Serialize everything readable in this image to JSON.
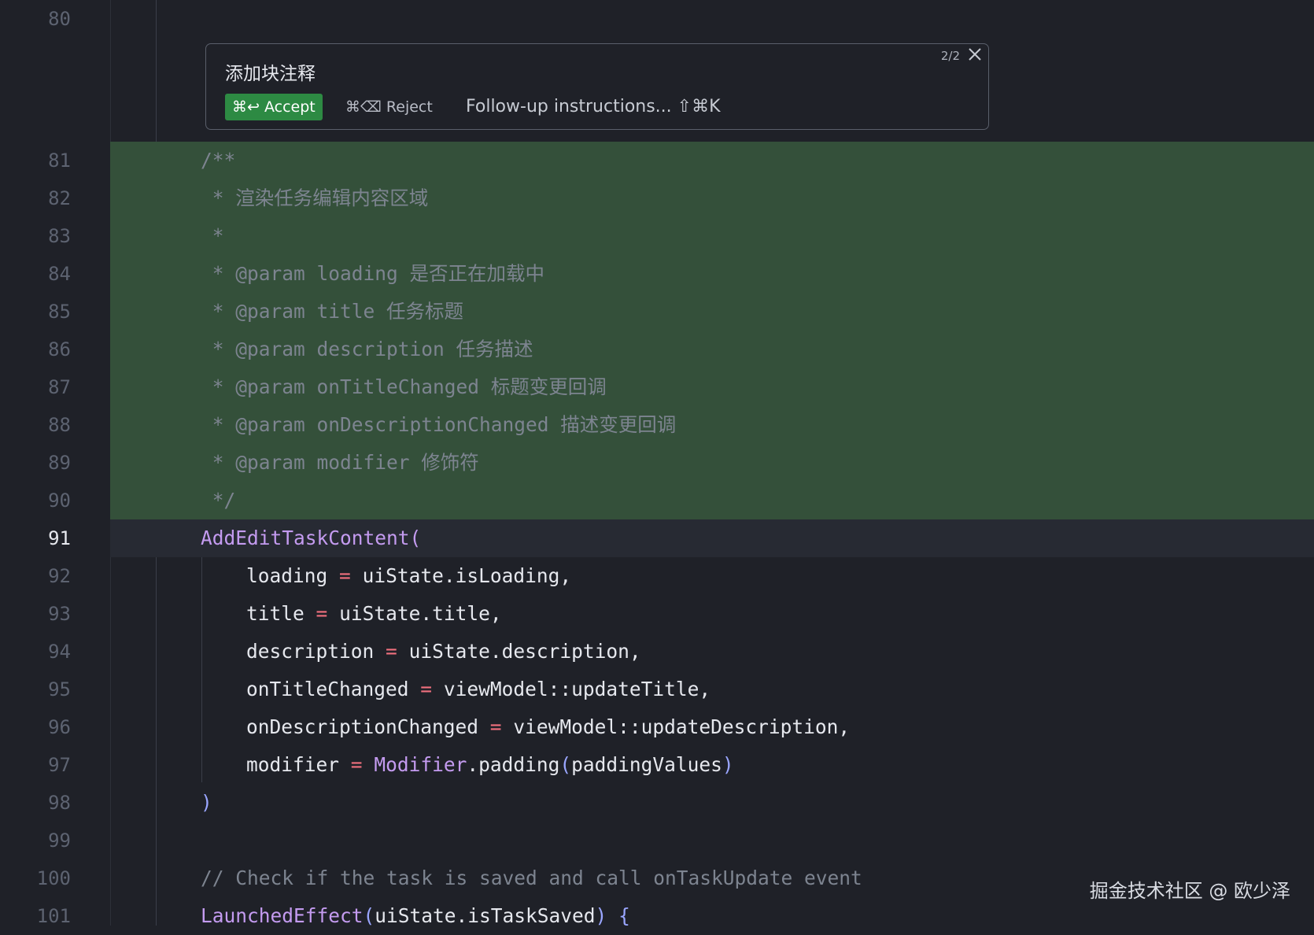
{
  "widget": {
    "title": "添加块注释",
    "counter": "2/2",
    "accept_shortcut": "⌘↩",
    "accept_label": "Accept",
    "reject_shortcut": "⌘⌫",
    "reject_label": "Reject",
    "followup_placeholder": "Follow-up instructions...",
    "followup_shortcut": "⇧⌘K"
  },
  "lines": [
    {
      "n": "80",
      "text": ""
    },
    {
      "n": "81",
      "text": "/**"
    },
    {
      "n": "82",
      "text": " * 渲染任务编辑内容区域"
    },
    {
      "n": "83",
      "text": " *"
    },
    {
      "n": "84",
      "text": " * @param loading 是否正在加载中"
    },
    {
      "n": "85",
      "text": " * @param title 任务标题"
    },
    {
      "n": "86",
      "text": " * @param description 任务描述"
    },
    {
      "n": "87",
      "text": " * @param onTitleChanged 标题变更回调"
    },
    {
      "n": "88",
      "text": " * @param onDescriptionChanged 描述变更回调"
    },
    {
      "n": "89",
      "text": " * @param modifier 修饰符"
    },
    {
      "n": "90",
      "text": " */"
    },
    {
      "n": "91",
      "fn": "AddEditTaskContent",
      "paren": "("
    },
    {
      "n": "92",
      "name": "loading",
      "eq": "=",
      "value": "uiState.isLoading,"
    },
    {
      "n": "93",
      "name": "title",
      "eq": "=",
      "value": "uiState.title,"
    },
    {
      "n": "94",
      "name": "description",
      "eq": "=",
      "value": "uiState.description,"
    },
    {
      "n": "95",
      "name": "onTitleChanged",
      "eq": "=",
      "value": "viewModel::updateTitle,"
    },
    {
      "n": "96",
      "name": "onDescriptionChanged",
      "eq": "=",
      "value": "viewModel::updateDescription,"
    },
    {
      "n": "97",
      "name": "modifier",
      "eq": "=",
      "cls": "Modifier",
      "call": ".padding",
      "open": "(",
      "arg": "paddingValues",
      "close": ")"
    },
    {
      "n": "98",
      "paren": ")"
    },
    {
      "n": "99",
      "text": ""
    },
    {
      "n": "100",
      "text": "// Check if the task is saved and call onTaskUpdate event"
    },
    {
      "n": "101",
      "fn": "LaunchedEffect",
      "open": "(",
      "arg": "uiState.isTaskSaved",
      "close": ")",
      "brace": " {"
    }
  ],
  "watermark": "掘金技术社区 @ 欧少泽",
  "colors": {
    "background": "#1f2128",
    "added_line": "#34503a",
    "accept_button": "#2d8a43",
    "function": "#c49bf0",
    "operator": "#f0707e",
    "comment": "#7d8490"
  }
}
